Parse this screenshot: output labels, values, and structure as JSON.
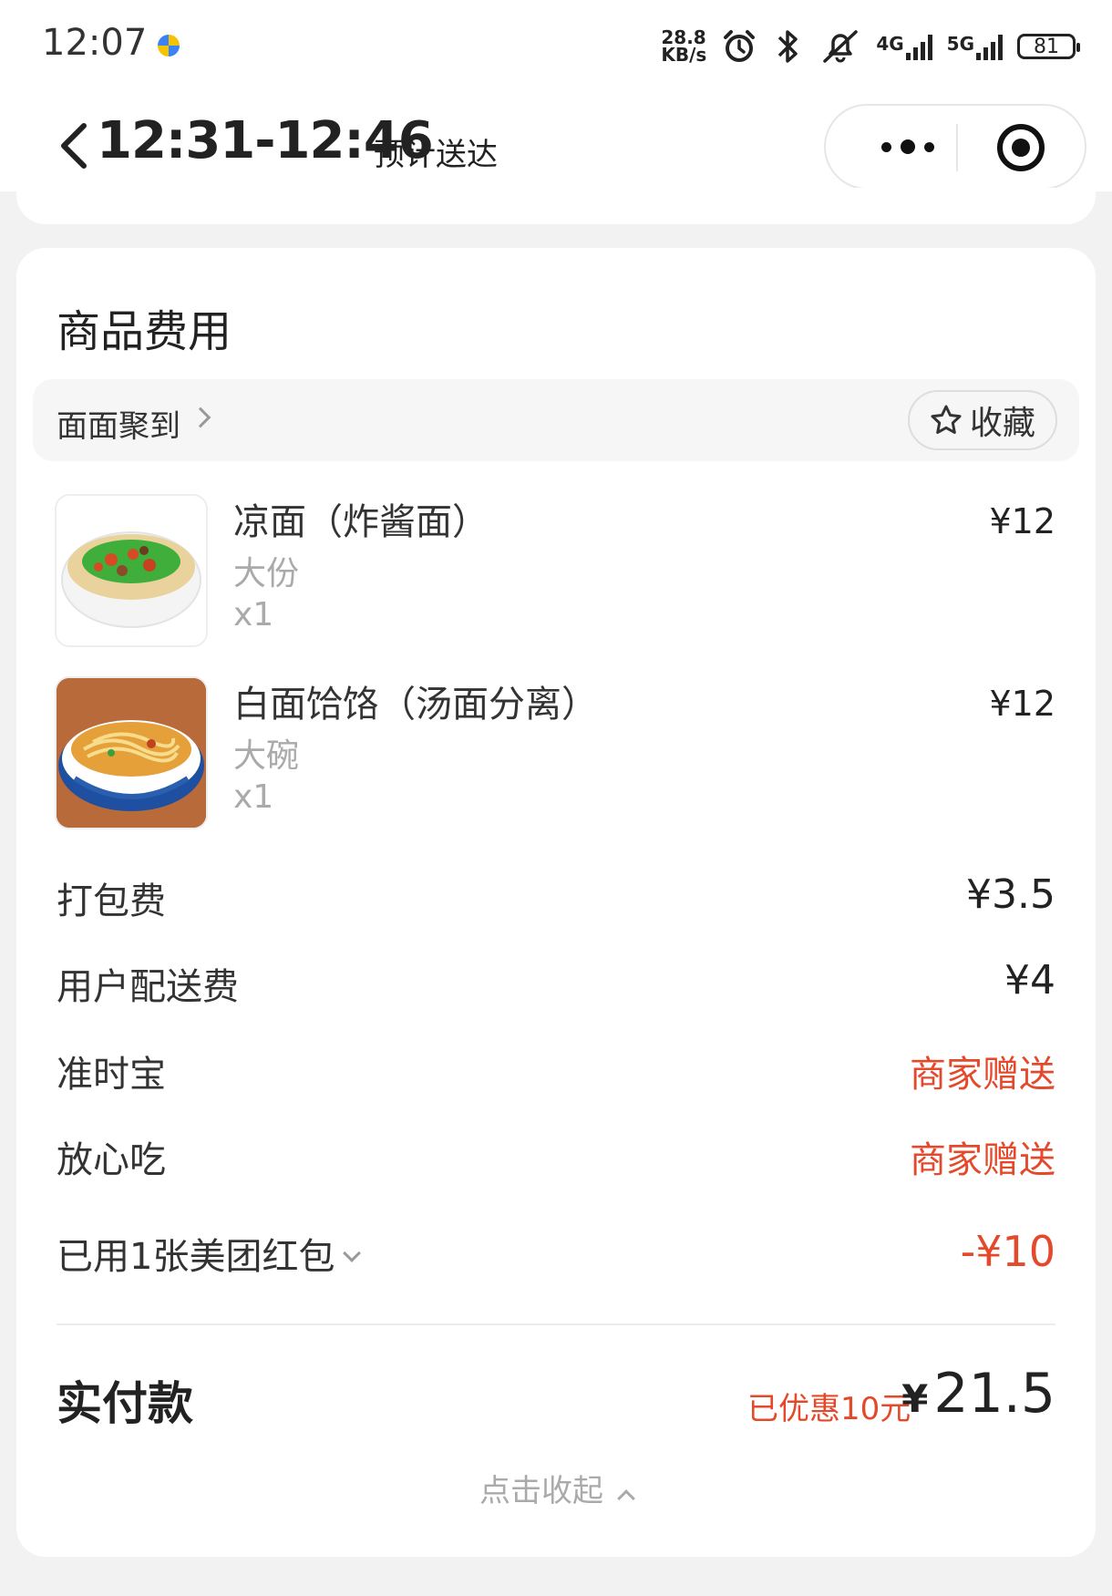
{
  "status_bar": {
    "time": "12:07",
    "net_speed_value": "28.8",
    "net_speed_unit": "KB/s",
    "signal1": "4G",
    "signal2": "5G",
    "battery": "81"
  },
  "header": {
    "eta": "12:31-12:46",
    "eta_label": "预计送达"
  },
  "section": {
    "title": "商品费用",
    "shop_name": "面面聚到",
    "favorite_label": "收藏"
  },
  "items": [
    {
      "name": "凉面（炸酱面）",
      "spec": "大份",
      "qty": "x1",
      "price": "¥12"
    },
    {
      "name": "白面饸饹（汤面分离）",
      "spec": "大碗",
      "qty": "x1",
      "price": "¥12"
    }
  ],
  "fees": [
    {
      "label": "打包费",
      "value": "¥3.5"
    },
    {
      "label": "用户配送费",
      "value": "¥4"
    },
    {
      "label": "准时宝",
      "value": "商家赠送"
    },
    {
      "label": "放心吃",
      "value": "商家赠送"
    },
    {
      "label": "已用1张美团红包",
      "value": "-¥10"
    }
  ],
  "payment": {
    "label": "实付款",
    "saved": "已优惠10元",
    "currency": "¥",
    "total": "21.5"
  },
  "collapse_label": "点击收起",
  "colors": {
    "accent_red": "#e5492b",
    "background": "#f2f2f2"
  }
}
